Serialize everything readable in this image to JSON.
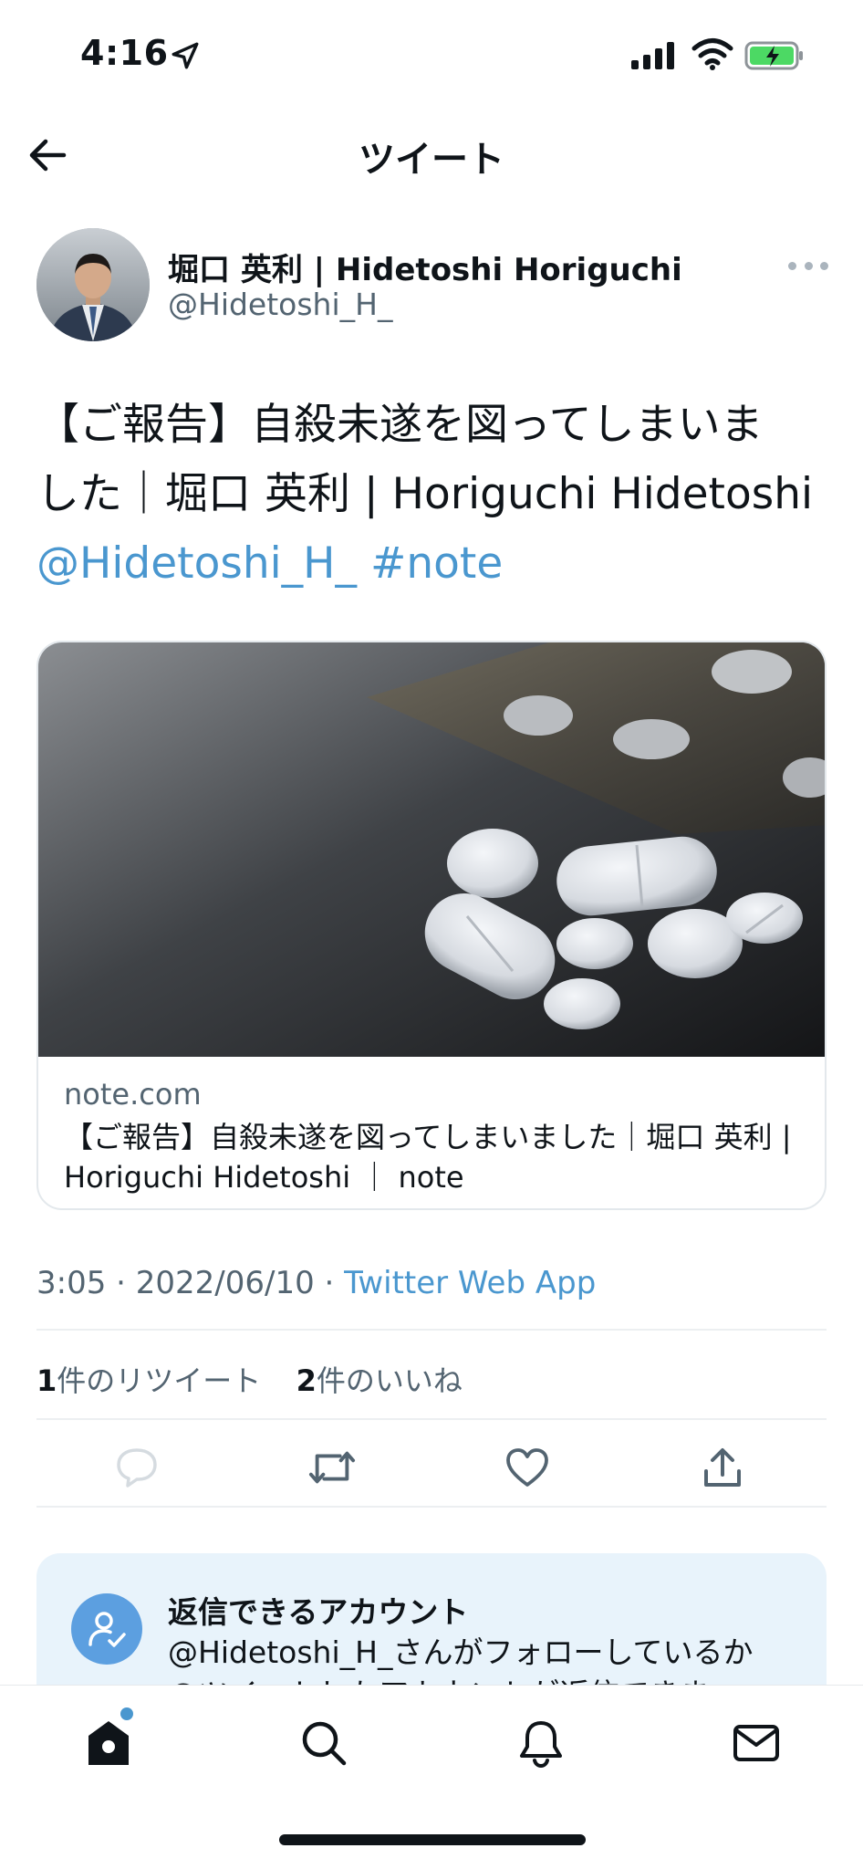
{
  "status_bar": {
    "time": "4:16",
    "icons": [
      "location-arrow-icon",
      "cellular-signal-icon",
      "wifi-icon",
      "battery-charging-icon"
    ],
    "battery_color": "#4cd964"
  },
  "header": {
    "title": "ツイート",
    "back_icon": "arrow-left-icon"
  },
  "tweet": {
    "author_name": "堀口 英利 | Hidetoshi Horiguchi",
    "author_handle": "@Hidetoshi_H_",
    "text_line1": "【ご報告】自殺未遂を図ってしまいま",
    "text_line2": "した｜堀口 英利 | Horiguchi Hidetoshi",
    "mention": "@Hidetoshi_H_",
    "hashtag": "#note",
    "timestamp": "3:05 · 2022/06/10 · ",
    "source": "Twitter Web App",
    "retweets_count": "1",
    "retweets_label": "件のリツイート",
    "likes_count": "2",
    "likes_label": "件のいいね"
  },
  "link_card": {
    "domain": "note.com",
    "title": "【ご報告】自殺未遂を図ってしまいました｜堀口 英利 | Horiguchi Hidetoshi ｜ note",
    "image": "photo of white pills on dark surface"
  },
  "actions": [
    "reply-icon",
    "retweet-icon",
    "like-icon",
    "share-icon"
  ],
  "reply_restriction": {
    "title": "返信できるアカウント",
    "desc_line1": "@Hidetoshi_H_さんがフォローしているか",
    "desc_line2": "@ツイートしたアカウントが返信できま"
  },
  "bottom_nav": [
    "home-icon",
    "search-icon",
    "notifications-icon",
    "messages-icon"
  ],
  "colors": {
    "link": "#4a97cf",
    "text": "#0f1419",
    "muted": "#536471",
    "reply_box_bg": "#e8f3fb"
  }
}
